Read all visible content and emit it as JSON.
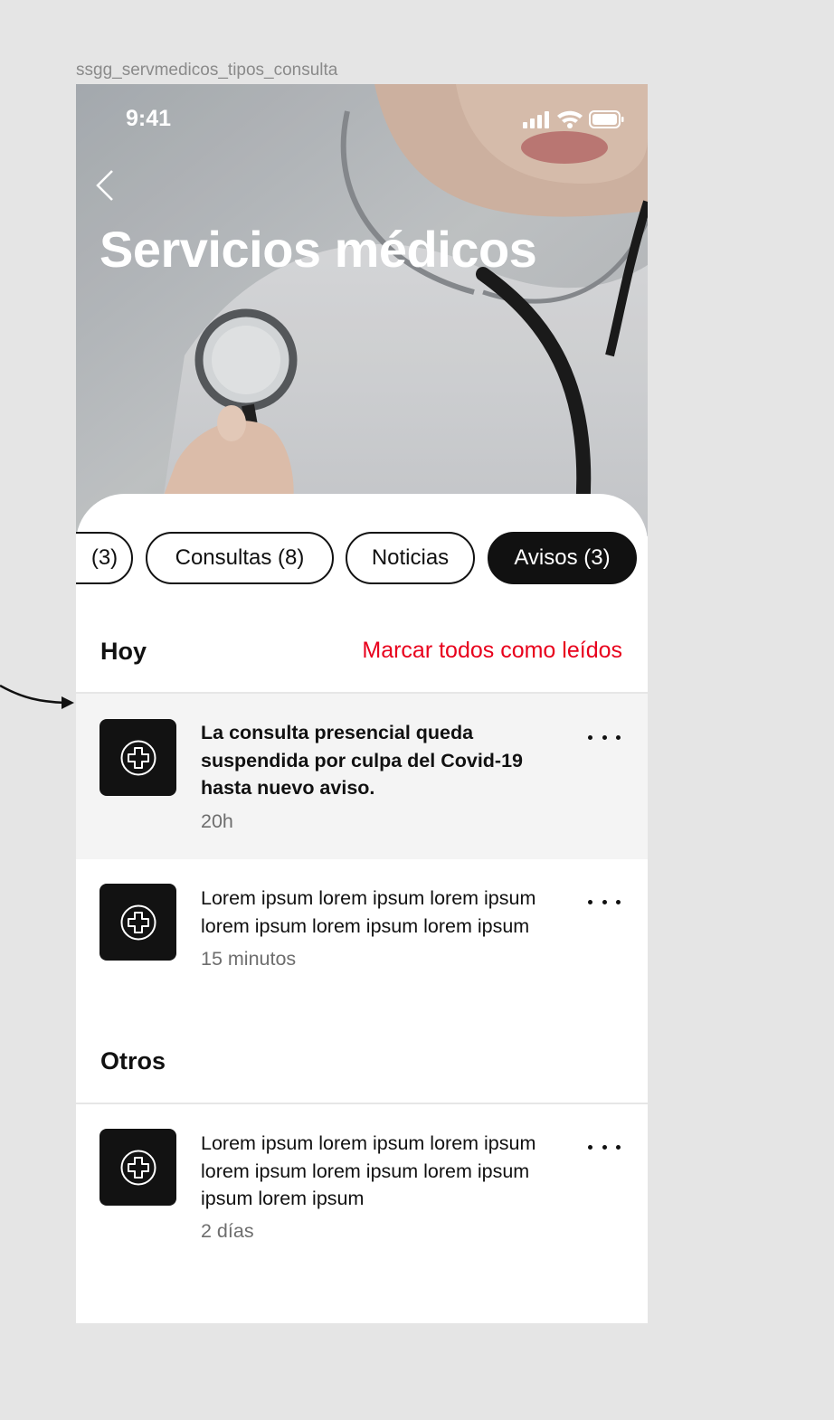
{
  "frame_label": "ssgg_servmedicos_tipos_consulta",
  "status_bar": {
    "time": "9:41",
    "signal_icon": "signal-bars-icon",
    "wifi_icon": "wifi-icon",
    "battery_icon": "battery-icon"
  },
  "header": {
    "back_icon": "chevron-left-icon",
    "title": "Servicios médicos"
  },
  "tabs": [
    {
      "label": "(3)",
      "active": false
    },
    {
      "label": "Consultas (8)",
      "active": false
    },
    {
      "label": "Noticias",
      "active": false
    },
    {
      "label": "Avisos (3)",
      "active": true
    }
  ],
  "sections": {
    "today": {
      "title": "Hoy",
      "mark_all": "Marcar todos como leídos"
    },
    "others": {
      "title": "Otros"
    }
  },
  "notifications": [
    {
      "text": "La consulta presencial queda suspendida por culpa del Covid-19 hasta nuevo aviso.",
      "time": "20h",
      "unread": true,
      "icon": "medical-cross-icon"
    },
    {
      "text": "Lorem ipsum lorem ipsum lorem ipsum lorem ipsum lorem ipsum lorem ipsum",
      "time": "15 minutos",
      "unread": false,
      "icon": "medical-cross-icon"
    },
    {
      "text": "Lorem ipsum lorem ipsum lorem ipsum lorem ipsum lorem ipsum lorem ipsum ipsum lorem ipsum",
      "time": "2 días",
      "unread": false,
      "icon": "medical-cross-icon"
    }
  ],
  "colors": {
    "accent": "#e8001c",
    "dark": "#111111",
    "unread_bg": "#f4f4f4"
  }
}
